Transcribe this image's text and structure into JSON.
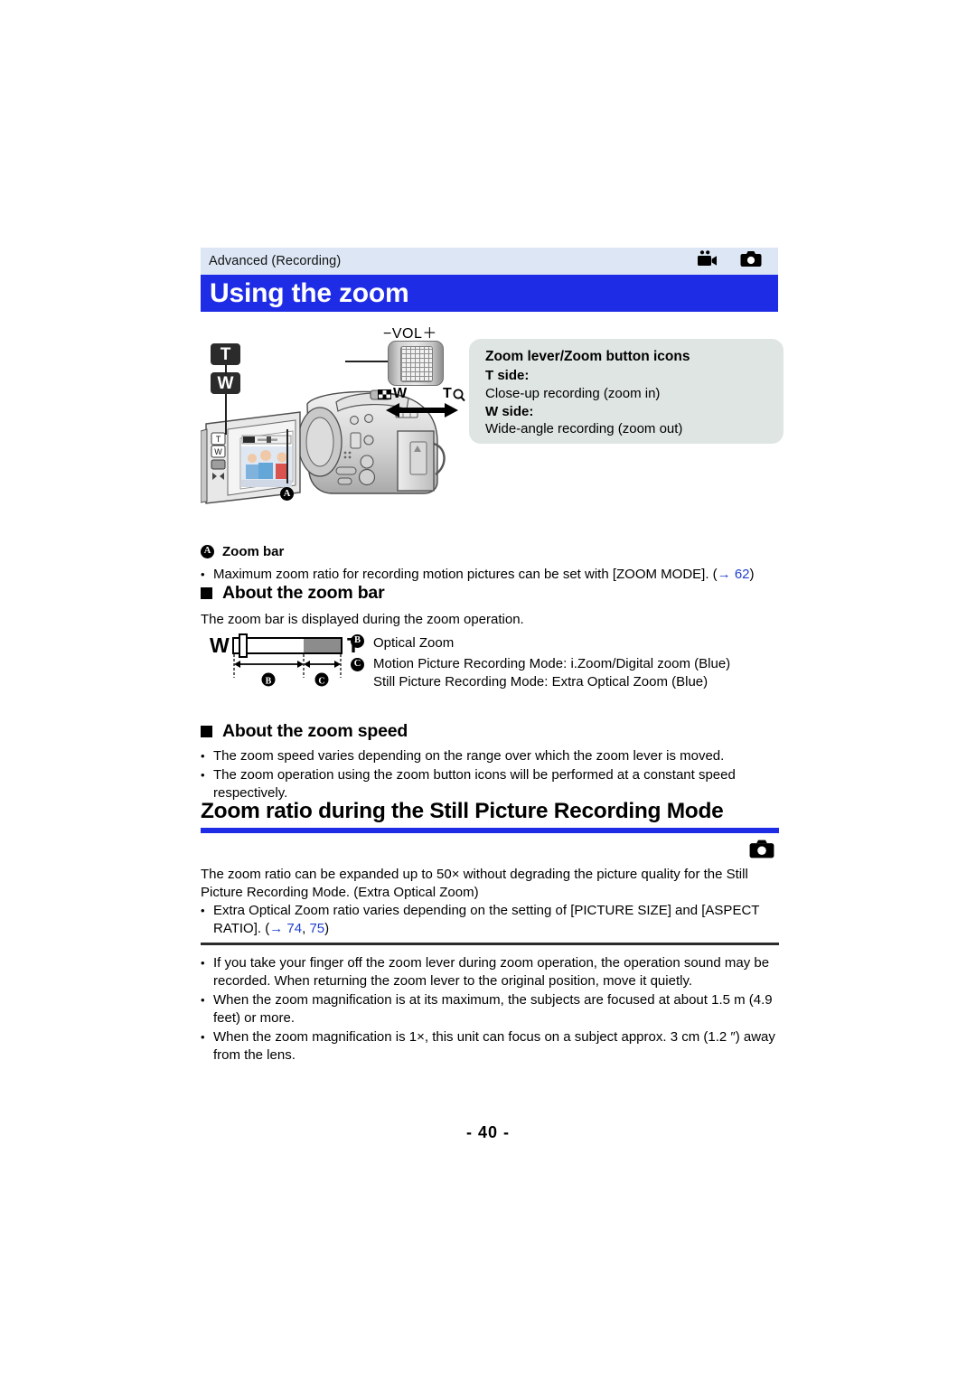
{
  "header": {
    "breadcrumb": "Advanced (Recording)",
    "icons": [
      "video-camera-icon",
      "still-camera-icon"
    ],
    "title": "Using the zoom",
    "title_bar_color": "#1f2ce6",
    "bar_color": "#dce6f4"
  },
  "illustration": {
    "button_T": "T",
    "button_W": "W",
    "vol_label": "−VOL＋",
    "lever_w_label": "W",
    "lever_t_label": "T",
    "callout_marker_A": "A",
    "lever_icons": [
      "checker-wide-icon",
      "magnifier-tele-icon",
      "double-arrow-icon"
    ]
  },
  "callout": {
    "title": "Zoom lever/Zoom button icons",
    "t_side_label": "T side:",
    "t_side_text": "Close-up recording (zoom in)",
    "w_side_label": "W side:",
    "w_side_text": "Wide-angle recording (zoom out)",
    "bg_color": "#dfe5e3"
  },
  "zoom_bar_caption": {
    "marker": "A",
    "label": "Zoom bar"
  },
  "bullets_top": [
    {
      "text_before": "Maximum zoom ratio for recording motion pictures can be set with [ZOOM MODE]. (",
      "arrow": "→",
      "page_ref": "62",
      "text_after": ")"
    }
  ],
  "section_zoom_bar": {
    "heading": "About the zoom bar",
    "intro": "The zoom bar is displayed during the zoom operation.",
    "figure": {
      "left_label": "W",
      "right_label": "T",
      "segment_B_label": "B",
      "segment_C_label": "C"
    },
    "legend": [
      {
        "marker": "B",
        "lines": [
          "Optical Zoom"
        ]
      },
      {
        "marker": "C",
        "lines": [
          "Motion Picture Recording Mode: i.Zoom/Digital zoom (Blue)",
          "Still Picture Recording Mode: Extra Optical Zoom (Blue)"
        ]
      }
    ]
  },
  "section_zoom_speed": {
    "heading": "About the zoom speed",
    "bullets": [
      "The zoom speed varies depending on the range over which the zoom lever is moved.",
      "The zoom operation using the zoom button icons will be performed at a constant speed respectively."
    ]
  },
  "section_still_zoom": {
    "heading": "Zoom ratio during the Still Picture Recording Mode",
    "underline_color": "#1f2ce6",
    "mode_icon": "still-camera-icon",
    "paragraph": "The zoom ratio can be expanded up to 50× without degrading the picture quality for the Still Picture Recording Mode. (Extra Optical Zoom)",
    "bullet": {
      "text_before": "Extra Optical Zoom ratio varies depending on the setting of [PICTURE SIZE] and [ASPECT RATIO]. (",
      "arrow": "→",
      "page_ref_1": "74",
      "comma": ", ",
      "page_ref_2": "75",
      "text_after": ")"
    }
  },
  "notes": [
    "If you take your finger off the zoom lever during zoom operation, the operation sound may be recorded. When returning the zoom lever to the original position, move it quietly.",
    "When the zoom magnification is at its maximum, the subjects are focused at about 1.5 m (4.9 feet) or more.",
    "When the zoom magnification is 1×, this unit can focus on a subject approx. 3 cm (1.2 ″) away from the lens."
  ],
  "footer": {
    "page_number": "- 40 -"
  }
}
